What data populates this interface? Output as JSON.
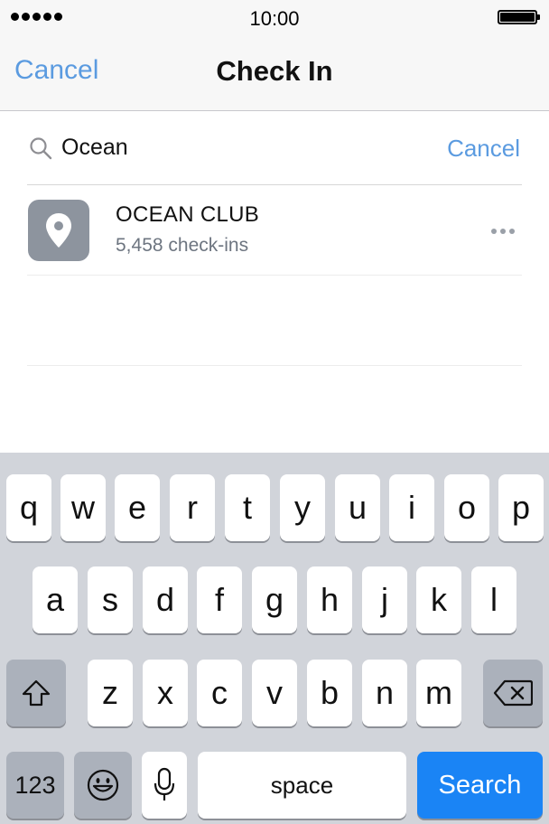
{
  "status_bar": {
    "time": "10:00",
    "signal_bars": 5
  },
  "nav": {
    "cancel_label": "Cancel",
    "title": "Check In"
  },
  "search": {
    "value": "Ocean",
    "cancel_label": "Cancel"
  },
  "results": [
    {
      "name": "OCEAN CLUB",
      "checkins": "5,458 check-ins",
      "icon": "location-pin-icon"
    }
  ],
  "keyboard": {
    "row1": [
      "q",
      "w",
      "e",
      "r",
      "t",
      "y",
      "u",
      "i",
      "o",
      "p"
    ],
    "row2": [
      "a",
      "s",
      "d",
      "f",
      "g",
      "h",
      "j",
      "k",
      "l"
    ],
    "row3": [
      "z",
      "x",
      "c",
      "v",
      "b",
      "n",
      "m"
    ],
    "numbers_label": "123",
    "space_label": "space",
    "search_label": "Search"
  },
  "colors": {
    "accent": "#5b9be0",
    "search_key": "#1a84f5",
    "keyboard_bg": "#d1d4da",
    "place_tile": "#8d949e"
  }
}
